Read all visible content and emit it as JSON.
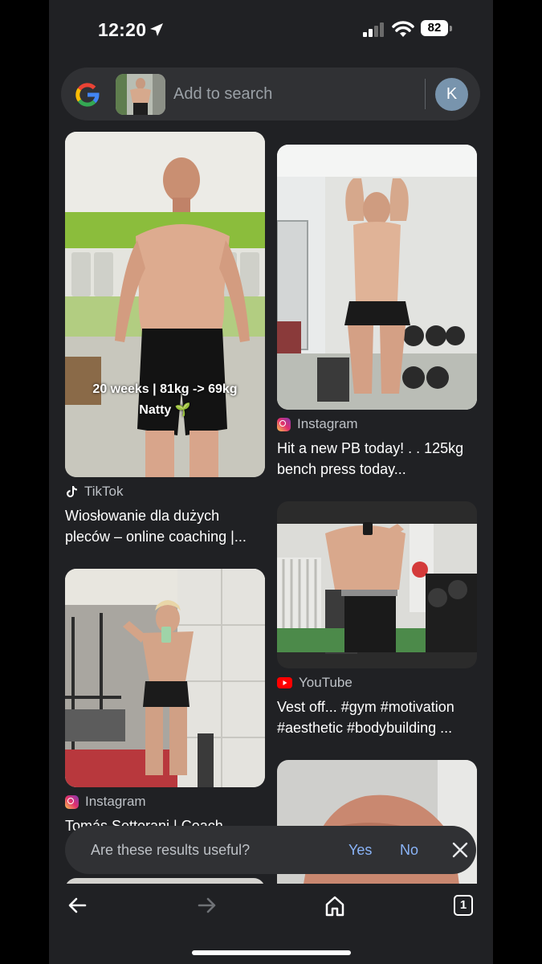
{
  "status_bar": {
    "time": "12:20",
    "battery": "82"
  },
  "search": {
    "placeholder": "Add to search",
    "avatar_letter": "K"
  },
  "results": [
    {
      "source": "TikTok",
      "title": "Wiosłowanie dla dużych pleców – online coaching |...",
      "overlay_line1": "20 weeks | 81kg -> 69kg",
      "overlay_line2": "Natty"
    },
    {
      "source": "Instagram",
      "title": "Hit a new PB today!   .   .   125kg bench press today..."
    },
    {
      "source": "YouTube",
      "title": "Vest off... #gym #motivation #aesthetic #bodybuilding ..."
    },
    {
      "source": "Instagram",
      "title": "Tomás Settorani | Coach"
    }
  ],
  "feedback": {
    "question": "Are these results useful?",
    "yes": "Yes",
    "no": "No"
  },
  "icons": {
    "google": "google-g-icon",
    "location": "location-arrow-icon",
    "signal": "cellular-signal-icon",
    "wifi": "wifi-icon",
    "tiktok": "tiktok-icon",
    "instagram": "instagram-icon",
    "youtube": "youtube-icon",
    "back": "back-arrow-icon",
    "forward": "forward-arrow-icon",
    "home": "home-icon",
    "tabs": "tab-switcher-icon",
    "close": "close-icon"
  },
  "toolbar": {
    "tab_count": "1"
  },
  "colors": {
    "background": "#202124",
    "surface": "#303134",
    "link": "#8ab4f8",
    "text": "#e8eaed"
  }
}
